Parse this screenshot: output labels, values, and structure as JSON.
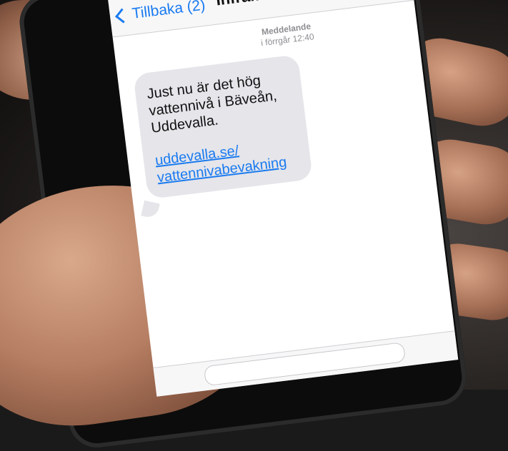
{
  "navbar": {
    "back_label": "Tillbaka (2)",
    "title": "Inframe"
  },
  "message_meta": {
    "sender_label": "Meddelande",
    "timestamp": "i förrgår 12:40"
  },
  "message": {
    "text": "Just nu är det hög vattennivå i Bäveån, Uddevalla.",
    "link": "uddevalla.se/ vattennivabevakning"
  },
  "colors": {
    "accent": "#1a7bf0",
    "bubble": "#e5e5ea"
  }
}
